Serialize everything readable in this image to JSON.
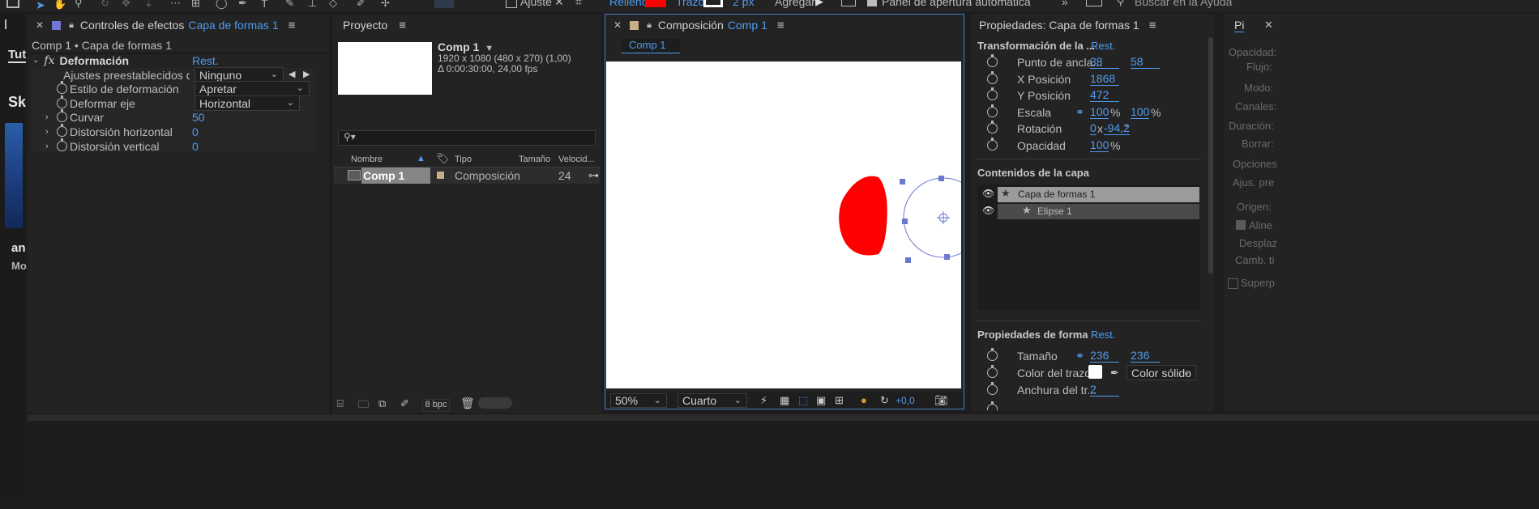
{
  "toolbar": {
    "ajuste_label": "Ajuste",
    "relleno_label": "Relleno:",
    "trazo_label": "Trazo:",
    "trazo_width": "2 px",
    "agregar_label": "Agregar:",
    "panel_apertura_label": "Panel de apertura automática",
    "search_placeholder": "Buscar en la Ayuda",
    "colors": {
      "fill": "#ff0000",
      "stroke": "#ffffff"
    }
  },
  "left_strip": {
    "tab_label": "Tut",
    "text_sk": "Sk",
    "text_an": "an",
    "text_mo": "Mo"
  },
  "effects_panel": {
    "title": "Controles de efectos",
    "layer_name": "Capa de formas 1",
    "breadcrumb": "Comp 1 • Capa de formas 1",
    "effect_name": "Deformación",
    "reset_label": "Rest.",
    "props": [
      {
        "label": "Ajustes preestablecidos de ani",
        "value": "Ninguno"
      },
      {
        "label": "Estilo de deformación",
        "value": "Apretar"
      },
      {
        "label": "Deformar eje",
        "value": "Horizontal"
      },
      {
        "label": "Curvar",
        "value": "50"
      },
      {
        "label": "Distorsión horizontal",
        "value": "0"
      },
      {
        "label": "Distorsión vertical",
        "value": "0"
      }
    ]
  },
  "project_panel": {
    "title": "Proyecto",
    "comp_name": "Comp 1",
    "comp_info_1": "1920 x 1080  (480 x 270) (1,00)",
    "comp_info_2": "Δ 0:00:30:00, 24,00 fps",
    "columns": {
      "name": "Nombre",
      "type": "Tipo",
      "size": "Tamaño",
      "speed": "Velocid..."
    },
    "items": [
      {
        "name": "Comp 1",
        "type": "Composición",
        "speed": "24"
      }
    ],
    "bpc_label": "8 bpc"
  },
  "composition_panel": {
    "title": "Composición",
    "comp_name": "Comp 1",
    "tab_label": "Comp 1",
    "zoom": "50%",
    "resolution": "Cuarto",
    "exposure": "+0,0"
  },
  "properties_panel": {
    "title": "Propiedades: Capa de formas 1",
    "transform_title": "Transformación de la ...",
    "reset_label": "Rest.",
    "transform": [
      {
        "label": "Punto de ancla...",
        "v1": "38",
        "v2": "58"
      },
      {
        "label": "X Posición",
        "v1": "1868"
      },
      {
        "label": "Y Posición",
        "v1": "472"
      },
      {
        "label": "Escala",
        "v1": "100",
        "u1": "%",
        "v2": "100",
        "u2": "%"
      },
      {
        "label": "Rotación",
        "v1": "0",
        "u1": "x",
        "v2": "-94,2",
        "u2": "°"
      },
      {
        "label": "Opacidad",
        "v1": "100",
        "u1": "%"
      }
    ],
    "contents_title": "Contenidos de la capa",
    "contents": [
      {
        "label": "Capa de formas 1"
      },
      {
        "label": "Elipse 1"
      }
    ],
    "shape_title": "Propiedades de forma",
    "shape_reset": "Rest.",
    "shape_props": [
      {
        "label": "Tamaño",
        "v1": "236",
        "v2": "236"
      },
      {
        "label": "Color del trazo",
        "mode": "Color sólido"
      },
      {
        "label": "Anchura del tr...",
        "v1": "2"
      }
    ],
    "stroke_color": "#ffffff"
  },
  "right_panel": {
    "tab_label": "Pi",
    "labels": [
      "Opacidad:",
      "Flujo:",
      "Modo:",
      "Canales:",
      "Duración:",
      "Borrar:",
      "Opciones",
      "Ajus. pre",
      "Origen:",
      "Aline",
      "Desplaz",
      "Camb. ti",
      "Superp"
    ]
  }
}
